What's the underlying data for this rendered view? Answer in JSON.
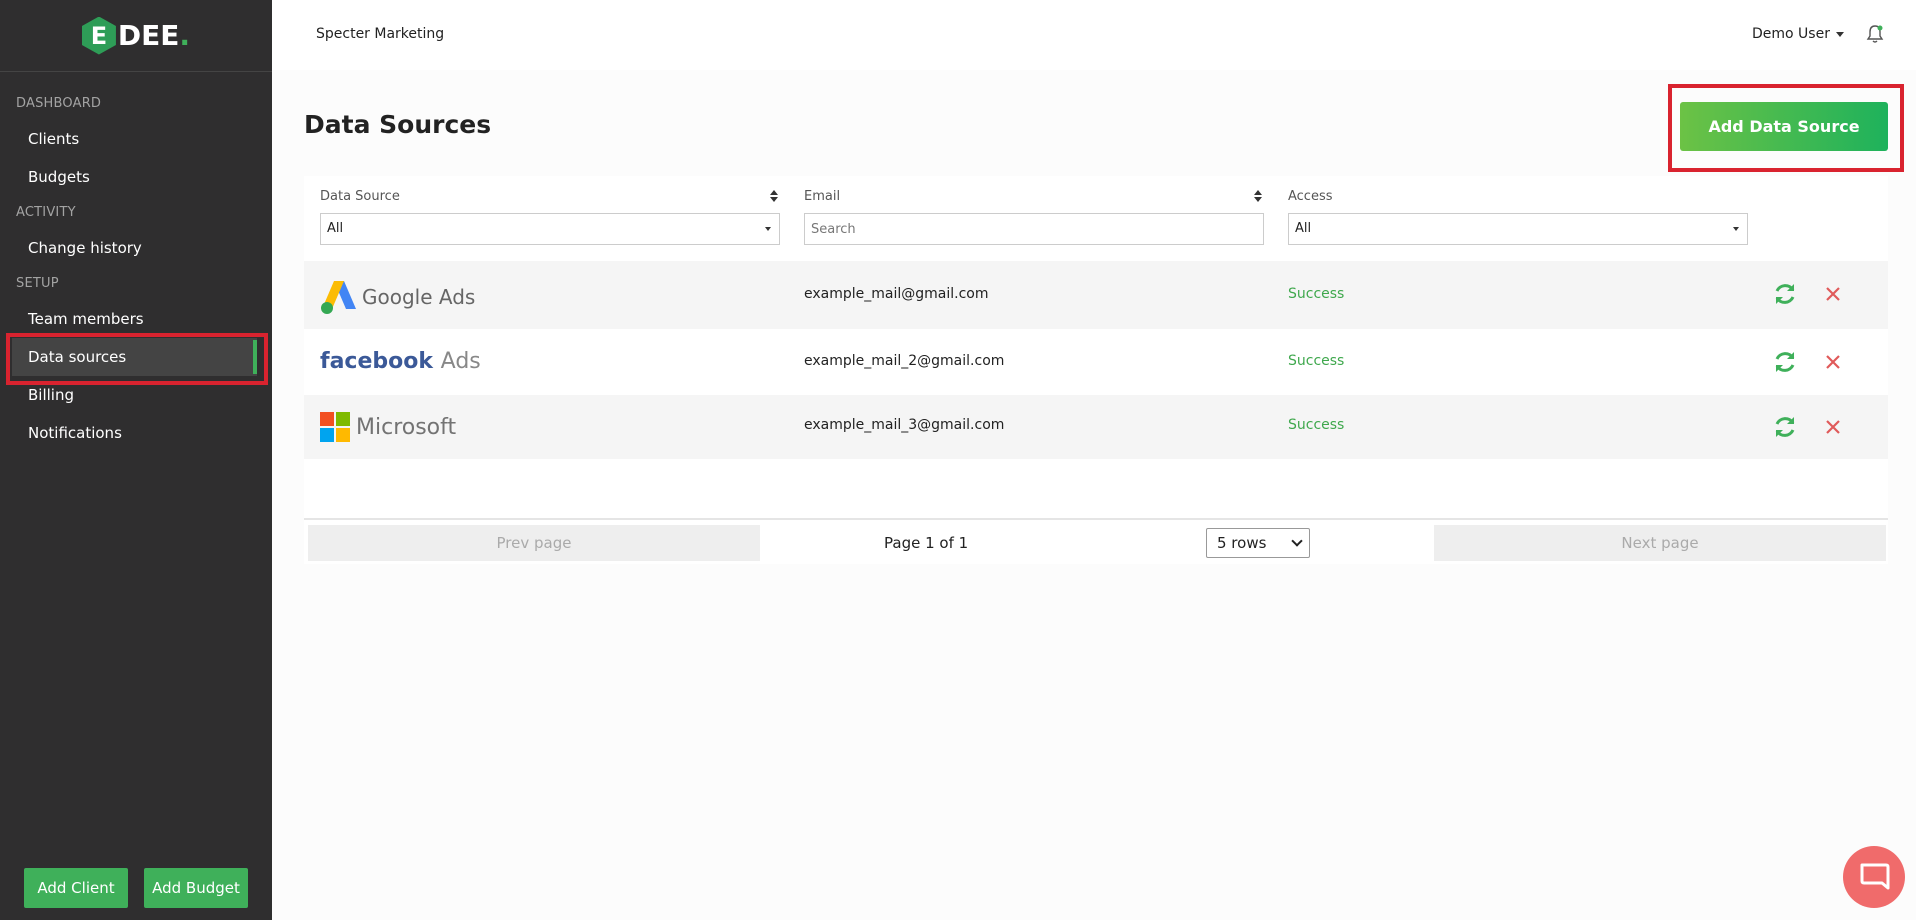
{
  "brand": {
    "logo_letter": "E",
    "logo_text": "DEE",
    "logo_dot": "."
  },
  "sidebar": {
    "sections": [
      {
        "title": "DASHBOARD",
        "items": [
          "Clients",
          "Budgets"
        ]
      },
      {
        "title": "ACTIVITY",
        "items": [
          "Change history"
        ]
      },
      {
        "title": "SETUP",
        "items": [
          "Team members",
          "Data sources",
          "Billing",
          "Notifications"
        ]
      }
    ],
    "active_item": "Data sources",
    "buttons": {
      "add_client": "Add Client",
      "add_budget": "Add Budget"
    }
  },
  "header": {
    "company": "Specter Marketing",
    "user": "Demo User",
    "bell_icon": "bell-icon"
  },
  "page": {
    "title": "Data Sources",
    "add_button": "Add Data Source"
  },
  "filters": {
    "data_source": {
      "label": "Data Source",
      "value": "All"
    },
    "email": {
      "label": "Email",
      "placeholder": "Search"
    },
    "access": {
      "label": "Access",
      "value": "All"
    }
  },
  "rows": [
    {
      "source": "Google Ads",
      "source_parts": [
        "Google",
        "Ads"
      ],
      "email": "example_mail@gmail.com",
      "status": "Success"
    },
    {
      "source": "facebook Ads",
      "source_parts": [
        "facebook",
        "Ads"
      ],
      "email": "example_mail_2@gmail.com",
      "status": "Success"
    },
    {
      "source": "Microsoft",
      "source_parts": [
        "Microsoft"
      ],
      "email": "example_mail_3@gmail.com",
      "status": "Success"
    }
  ],
  "pagination": {
    "prev": "Prev page",
    "info": "Page 1 of 1",
    "rows_select": "5 rows",
    "next": "Next page"
  },
  "colors": {
    "accent": "#3fb05a",
    "sidebar_bg": "#2f2e2f",
    "status_success": "#3fa84d",
    "delete": "#e05a5a",
    "highlight": "#d9232f",
    "chat": "#f06b6b"
  }
}
